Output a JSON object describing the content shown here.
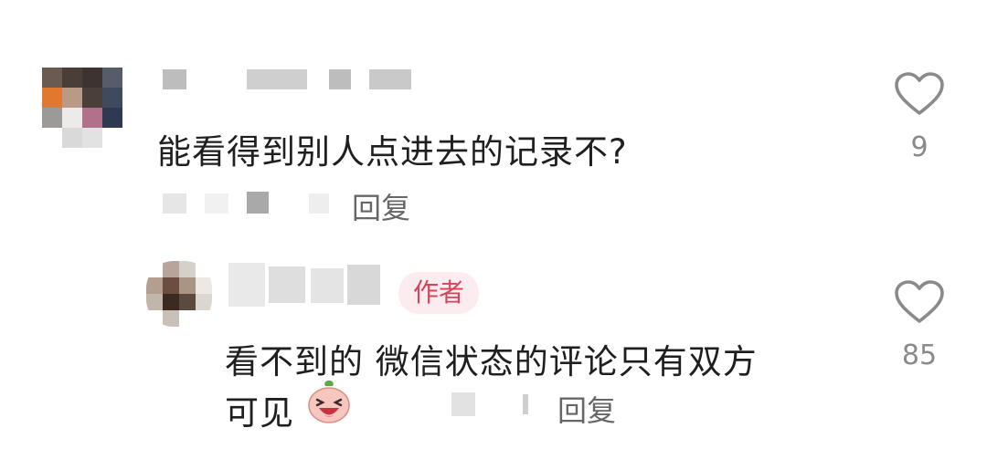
{
  "comments": [
    {
      "text": "能看得到别人点进去的记录不?",
      "reply_label": "回复",
      "likes": "9",
      "icon": "heart-outline-icon"
    },
    {
      "badge": "作者",
      "text_line1": "看不到的 微信状态的评论只有双方",
      "text_line2": "可见",
      "emoji": "laughing-peach-emoji",
      "reply_label": "回复",
      "likes": "85",
      "icon": "heart-outline-icon"
    }
  ],
  "colors": {
    "text": "#1f1f1f",
    "meta": "#8a8a8a",
    "badge_bg": "#fdecef",
    "badge_text": "#d6435a"
  }
}
